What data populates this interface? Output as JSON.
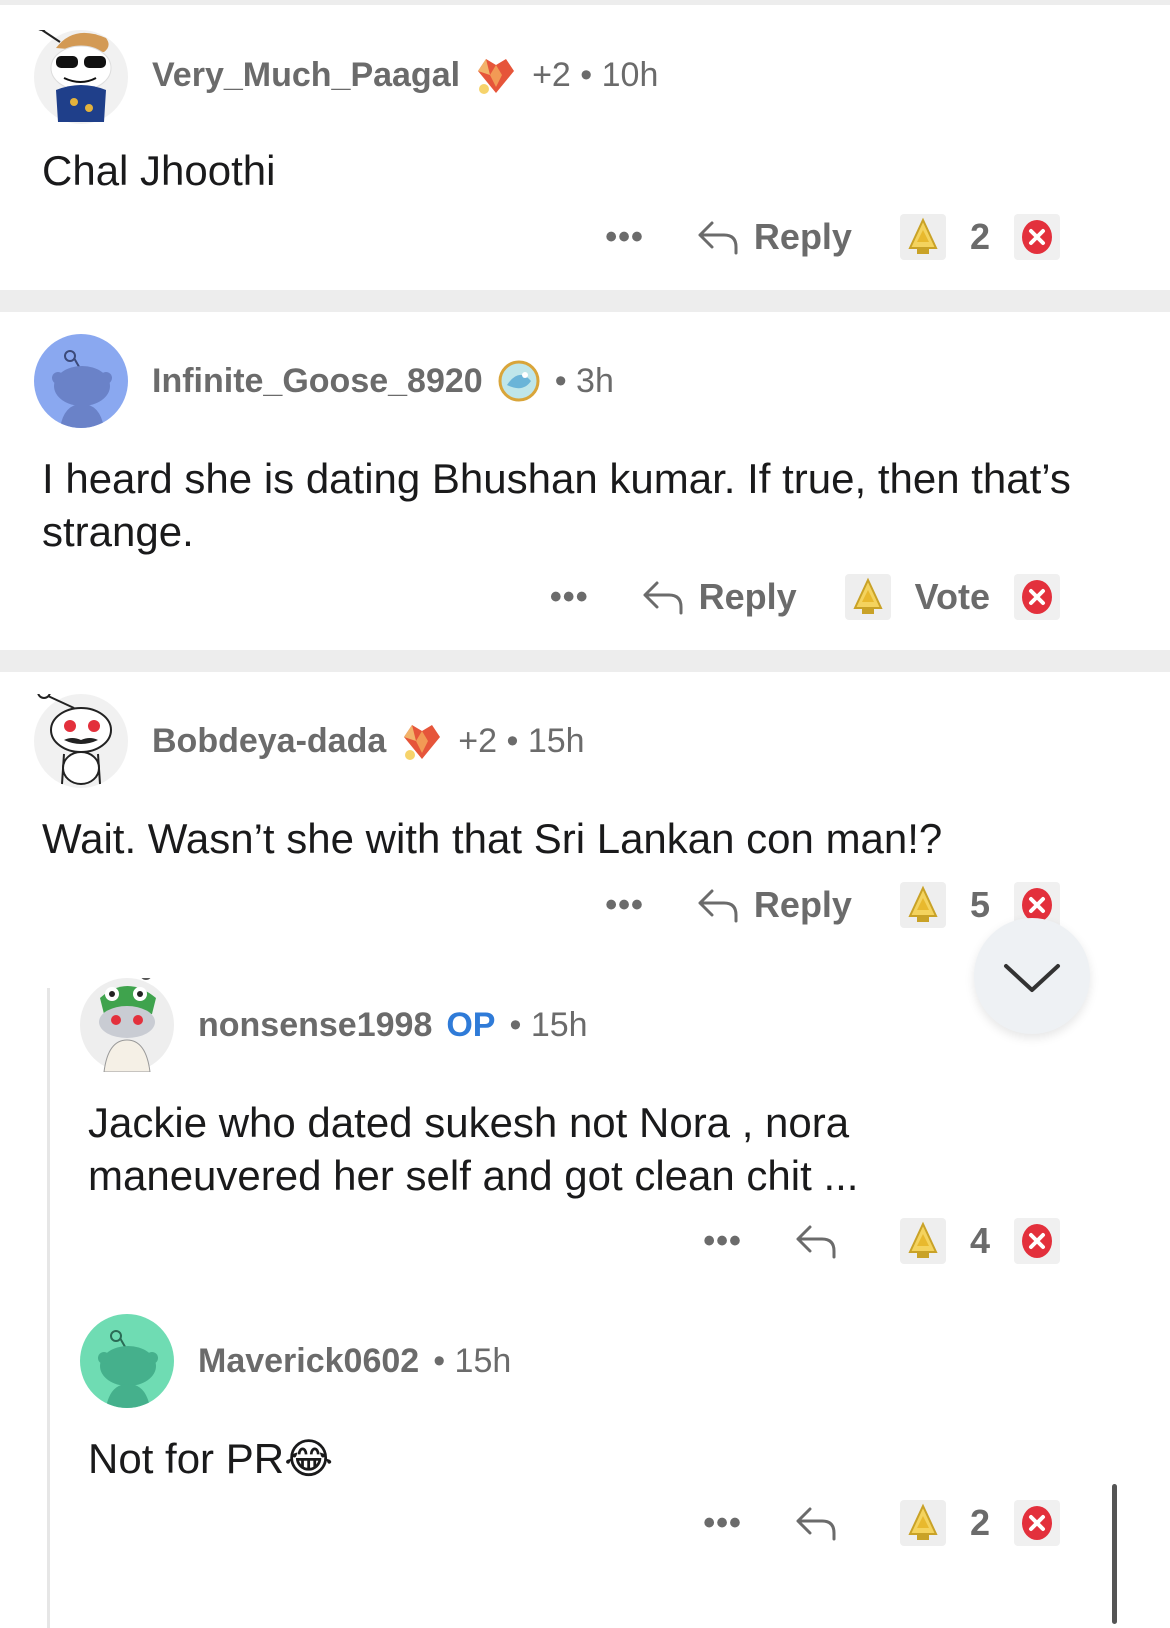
{
  "comments": [
    {
      "username": "Very_Much_Paagal",
      "meta": "+2 • 10h",
      "op": "",
      "text": "Chal Jhoothi",
      "reply_label": "Reply",
      "score": "2",
      "flair_icon": "crystal-heart-icon"
    },
    {
      "username": "Infinite_Goose_8920",
      "meta": "• 3h",
      "op": "",
      "text": "I heard she is dating Bhushan kumar. If true, then that’s strange.",
      "reply_label": "Reply",
      "score": "Vote",
      "flair_icon": "orb-icon"
    },
    {
      "username": "Bobdeya-dada",
      "meta": "+2 • 15h",
      "op": "",
      "text": "Wait. Wasn’t she with that Sri Lankan con man!?",
      "reply_label": "Reply",
      "score": "5",
      "flair_icon": "crystal-heart-icon"
    },
    {
      "username": "nonsense1998",
      "meta": "• 15h",
      "op": "OP",
      "text": "Jackie who dated sukesh not Nora , nora maneuvered her self and got clean chit ...",
      "reply_label": "",
      "score": "4"
    },
    {
      "username": "Maverick0602",
      "meta": "• 15h",
      "op": "",
      "text": "Not for PR",
      "emoji": "😂",
      "reply_label": "",
      "score": "2"
    }
  ],
  "more_dots": "•••",
  "colors": {
    "accent_op": "#2f7bd8",
    "text_muted": "#6b6b6b",
    "separator": "#ededed",
    "downvote": "#e3303c"
  }
}
